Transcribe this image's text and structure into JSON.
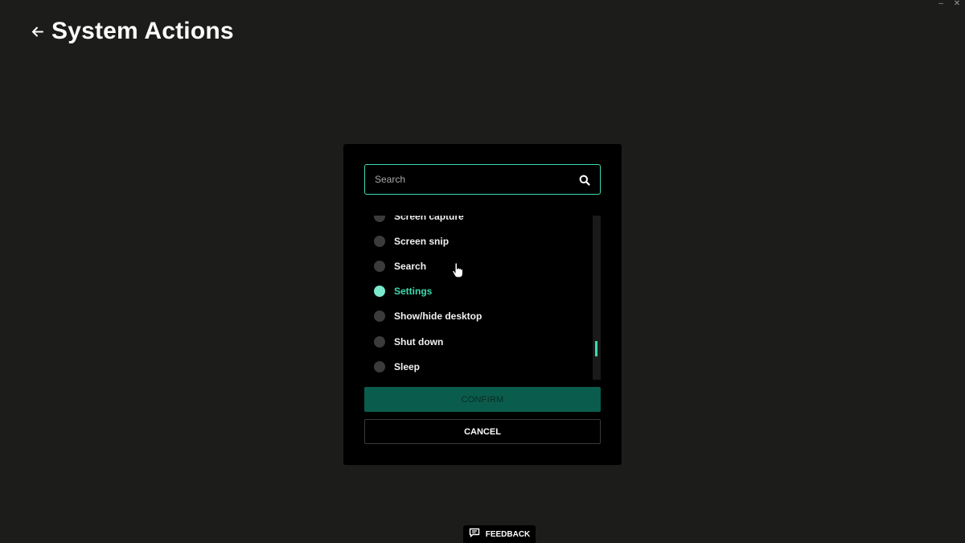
{
  "window": {
    "minimize_glyph": "–",
    "close_glyph": "✕"
  },
  "header": {
    "back_icon": "arrow-left-icon",
    "title": "System Actions"
  },
  "dialog": {
    "search": {
      "placeholder": "Search",
      "value": "",
      "icon": "search-icon"
    },
    "items": [
      {
        "label": "Screen capture",
        "selected": false
      },
      {
        "label": "Screen snip",
        "selected": false
      },
      {
        "label": "Search",
        "selected": false
      },
      {
        "label": "Settings",
        "selected": true
      },
      {
        "label": "Show/hide desktop",
        "selected": false
      },
      {
        "label": "Shut down",
        "selected": false
      },
      {
        "label": "Sleep",
        "selected": false
      }
    ],
    "confirm_label": "CONFIRM",
    "cancel_label": "CANCEL"
  },
  "feedback": {
    "label": "FEEDBACK",
    "icon": "feedback-icon"
  },
  "colors": {
    "background": "#1c1d1b",
    "accent": "#3ddbb0",
    "confirm_bg": "#0a5d4d"
  }
}
